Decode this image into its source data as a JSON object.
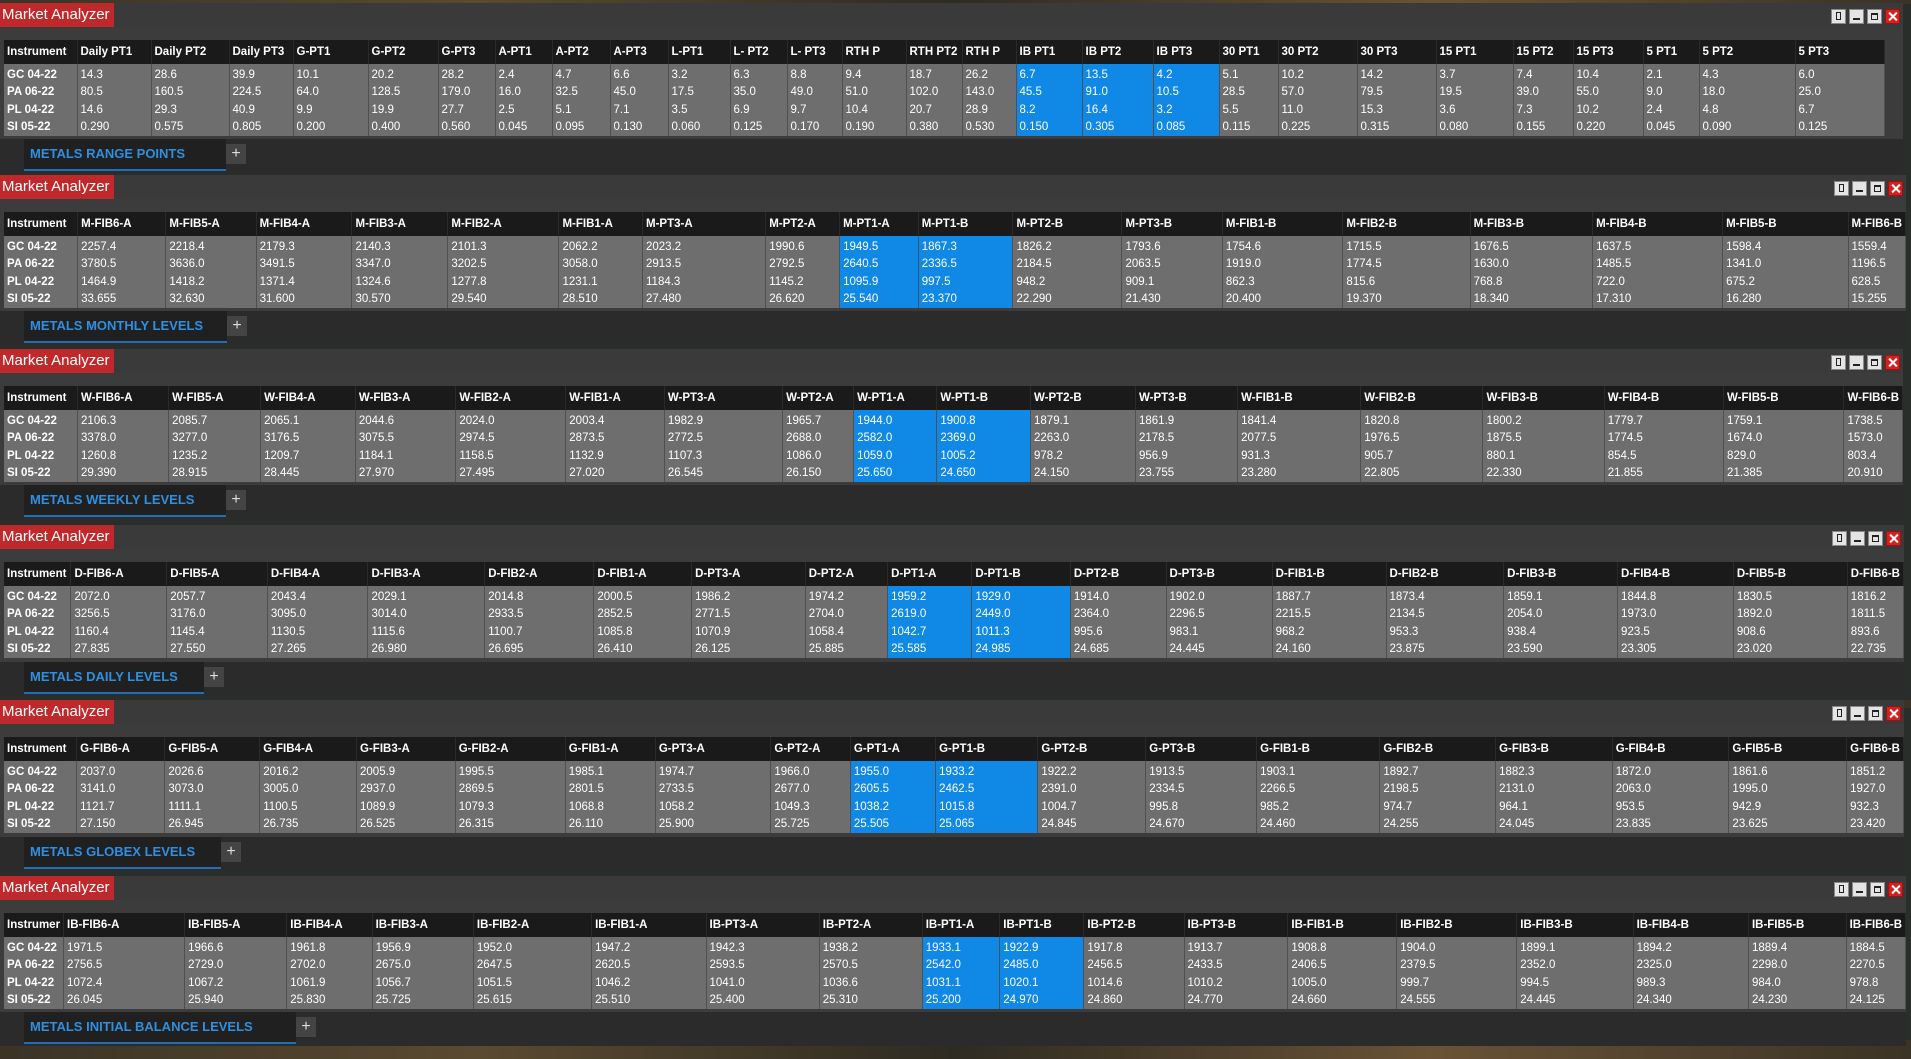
{
  "app_title": "Market Analyzer",
  "windows": [
    {
      "tab_label": "METALS RANGE POINTS",
      "headers": [
        "Instrument",
        "Daily PT1",
        "Daily PT2",
        "Daily PT3",
        "G-PT1",
        "G-PT2",
        "G-PT3",
        "A-PT1",
        "A-PT2",
        "A-PT3",
        "L-PT1",
        "L- PT2",
        "L- PT3",
        "RTH P",
        "RTH PT2",
        "RTH P",
        "IB PT1",
        "IB PT2",
        "IB PT3",
        "30 PT1",
        "30 PT2",
        "30 PT3",
        "15 PT1",
        "15 PT2",
        "15 PT3",
        "5 PT1",
        "5 PT2",
        "5 PT3"
      ],
      "rows": [
        [
          "GC 04-22",
          "14.3",
          "28.6",
          "39.9",
          "10.1",
          "20.2",
          "28.2",
          "2.4",
          "4.7",
          "6.6",
          "3.2",
          "6.3",
          "8.8",
          "9.4",
          "18.7",
          "26.2",
          "6.7",
          "13.5",
          "4.2",
          "5.1",
          "10.2",
          "14.2",
          "3.7",
          "7.4",
          "10.4",
          "2.1",
          "4.3",
          "6.0"
        ],
        [
          "PA 06-22",
          "80.5",
          "160.5",
          "224.5",
          "64.0",
          "128.5",
          "179.0",
          "16.0",
          "32.5",
          "45.0",
          "17.5",
          "35.0",
          "49.0",
          "51.0",
          "102.0",
          "143.0",
          "45.5",
          "91.0",
          "10.5",
          "28.5",
          "57.0",
          "79.5",
          "19.5",
          "39.0",
          "55.0",
          "9.0",
          "18.0",
          "25.0"
        ],
        [
          "PL 04-22",
          "14.6",
          "29.3",
          "40.9",
          "9.9",
          "19.9",
          "27.7",
          "2.5",
          "5.1",
          "7.1",
          "3.5",
          "6.9",
          "9.7",
          "10.4",
          "20.7",
          "28.9",
          "8.2",
          "16.4",
          "3.2",
          "5.5",
          "11.0",
          "15.3",
          "3.6",
          "7.3",
          "10.2",
          "2.4",
          "4.8",
          "6.7"
        ],
        [
          "SI 05-22",
          "0.290",
          "0.575",
          "0.805",
          "0.200",
          "0.400",
          "0.560",
          "0.045",
          "0.095",
          "0.130",
          "0.060",
          "0.125",
          "0.170",
          "0.190",
          "0.380",
          "0.530",
          "0.150",
          "0.305",
          "0.085",
          "0.115",
          "0.225",
          "0.315",
          "0.080",
          "0.155",
          "0.220",
          "0.045",
          "0.090",
          "0.125"
        ]
      ]
    },
    {
      "tab_label": "METALS MONTHLY LEVELS",
      "headers": [
        "Instrument",
        "M-FIB6-A",
        "M-FIB5-A",
        "M-FIB4-A",
        "M-FIB3-A",
        "M-FIB2-A",
        "M-FIB1-A",
        "M-PT3-A",
        "M-PT2-A",
        "M-PT1-A",
        "M-PT1-B",
        "M-PT2-B",
        "M-PT3-B",
        "M-FIB1-B",
        "M-FIB2-B",
        "M-FIB3-B",
        "M-FIB4-B",
        "M-FIB5-B",
        "M-FIB6-B"
      ],
      "rows": [
        [
          "GC 04-22",
          "2257.4",
          "2218.4",
          "2179.3",
          "2140.3",
          "2101.3",
          "2062.2",
          "2023.2",
          "1990.6",
          "1949.5",
          "1867.3",
          "1826.2",
          "1793.6",
          "1754.6",
          "1715.5",
          "1676.5",
          "1637.5",
          "1598.4",
          "1559.4"
        ],
        [
          "PA 06-22",
          "3780.5",
          "3636.0",
          "3491.5",
          "3347.0",
          "3202.5",
          "3058.0",
          "2913.5",
          "2792.5",
          "2640.5",
          "2336.5",
          "2184.5",
          "2063.5",
          "1919.0",
          "1774.5",
          "1630.0",
          "1485.5",
          "1341.0",
          "1196.5"
        ],
        [
          "PL 04-22",
          "1464.9",
          "1418.2",
          "1371.4",
          "1324.6",
          "1277.8",
          "1231.1",
          "1184.3",
          "1145.2",
          "1095.9",
          "997.5",
          "948.2",
          "909.1",
          "862.3",
          "815.6",
          "768.8",
          "722.0",
          "675.2",
          "628.5"
        ],
        [
          "SI 05-22",
          "33.655",
          "32.630",
          "31.600",
          "30.570",
          "29.540",
          "28.510",
          "27.480",
          "26.620",
          "25.540",
          "23.370",
          "22.290",
          "21.430",
          "20.400",
          "19.370",
          "18.340",
          "17.310",
          "16.280",
          "15.255"
        ]
      ]
    },
    {
      "tab_label": "METALS WEEKLY LEVELS",
      "headers": [
        "Instrument",
        "W-FIB6-A",
        "W-FIB5-A",
        "W-FIB4-A",
        "W-FIB3-A",
        "W-FIB2-A",
        "W-FIB1-A",
        "W-PT3-A",
        "W-PT2-A",
        "W-PT1-A",
        "W-PT1-B",
        "W-PT2-B",
        "W-PT3-B",
        "W-FIB1-B",
        "W-FIB2-B",
        "W-FIB3-B",
        "W-FIB4-B",
        "W-FIB5-B",
        "W-FIB6-B"
      ],
      "rows": [
        [
          "GC 04-22",
          "2106.3",
          "2085.7",
          "2065.1",
          "2044.6",
          "2024.0",
          "2003.4",
          "1982.9",
          "1965.7",
          "1944.0",
          "1900.8",
          "1879.1",
          "1861.9",
          "1841.4",
          "1820.8",
          "1800.2",
          "1779.7",
          "1759.1",
          "1738.5"
        ],
        [
          "PA 06-22",
          "3378.0",
          "3277.0",
          "3176.5",
          "3075.5",
          "2974.5",
          "2873.5",
          "2772.5",
          "2688.0",
          "2582.0",
          "2369.0",
          "2263.0",
          "2178.5",
          "2077.5",
          "1976.5",
          "1875.5",
          "1774.5",
          "1674.0",
          "1573.0"
        ],
        [
          "PL 04-22",
          "1260.8",
          "1235.2",
          "1209.7",
          "1184.1",
          "1158.5",
          "1132.9",
          "1107.3",
          "1086.0",
          "1059.0",
          "1005.2",
          "978.2",
          "956.9",
          "931.3",
          "905.7",
          "880.1",
          "854.5",
          "829.0",
          "803.4"
        ],
        [
          "SI 05-22",
          "29.390",
          "28.915",
          "28.445",
          "27.970",
          "27.495",
          "27.020",
          "26.545",
          "26.150",
          "25.650",
          "24.650",
          "24.150",
          "23.755",
          "23.280",
          "22.805",
          "22.330",
          "21.855",
          "21.385",
          "20.910"
        ]
      ]
    },
    {
      "tab_label": "METALS DAILY LEVELS",
      "headers": [
        "Instrument",
        "D-FIB6-A",
        "D-FIB5-A",
        "D-FIB4-A",
        "D-FIB3-A",
        "D-FIB2-A",
        "D-FIB1-A",
        "D-PT3-A",
        "D-PT2-A",
        "D-PT1-A",
        "D-PT1-B",
        "D-PT2-B",
        "D-PT3-B",
        "D-FIB1-B",
        "D-FIB2-B",
        "D-FIB3-B",
        "D-FIB4-B",
        "D-FIB5-B",
        "D-FIB6-B"
      ],
      "rows": [
        [
          "GC 04-22",
          "2072.0",
          "2057.7",
          "2043.4",
          "2029.1",
          "2014.8",
          "2000.5",
          "1986.2",
          "1974.2",
          "1959.2",
          "1929.0",
          "1914.0",
          "1902.0",
          "1887.7",
          "1873.4",
          "1859.1",
          "1844.8",
          "1830.5",
          "1816.2"
        ],
        [
          "PA 06-22",
          "3256.5",
          "3176.0",
          "3095.0",
          "3014.0",
          "2933.5",
          "2852.5",
          "2771.5",
          "2704.0",
          "2619.0",
          "2449.0",
          "2364.0",
          "2296.5",
          "2215.5",
          "2134.5",
          "2054.0",
          "1973.0",
          "1892.0",
          "1811.5"
        ],
        [
          "PL 04-22",
          "1160.4",
          "1145.4",
          "1130.5",
          "1115.6",
          "1100.7",
          "1085.8",
          "1070.9",
          "1058.4",
          "1042.7",
          "1011.3",
          "995.6",
          "983.1",
          "968.2",
          "953.3",
          "938.4",
          "923.5",
          "908.6",
          "893.6"
        ],
        [
          "SI 05-22",
          "27.835",
          "27.550",
          "27.265",
          "26.980",
          "26.695",
          "26.410",
          "26.125",
          "25.885",
          "25.585",
          "24.985",
          "24.685",
          "24.445",
          "24.160",
          "23.875",
          "23.590",
          "23.305",
          "23.020",
          "22.735"
        ]
      ]
    },
    {
      "tab_label": "METALS GLOBEX LEVELS",
      "headers": [
        "Instrument",
        "G-FIB6-A",
        "G-FIB5-A",
        "G-FIB4-A",
        "G-FIB3-A",
        "G-FIB2-A",
        "G-FIB1-A",
        "G-PT3-A",
        "G-PT2-A",
        "G-PT1-A",
        "G-PT1-B",
        "G-PT2-B",
        "G-PT3-B",
        "G-FIB1-B",
        "G-FIB2-B",
        "G-FIB3-B",
        "G-FIB4-B",
        "G-FIB5-B",
        "G-FIB6-B"
      ],
      "rows": [
        [
          "GC 04-22",
          "2037.0",
          "2026.6",
          "2016.2",
          "2005.9",
          "1995.5",
          "1985.1",
          "1974.7",
          "1966.0",
          "1955.0",
          "1933.2",
          "1922.2",
          "1913.5",
          "1903.1",
          "1892.7",
          "1882.3",
          "1872.0",
          "1861.6",
          "1851.2"
        ],
        [
          "PA 06-22",
          "3141.0",
          "3073.0",
          "3005.0",
          "2937.0",
          "2869.5",
          "2801.5",
          "2733.5",
          "2677.0",
          "2605.5",
          "2462.5",
          "2391.0",
          "2334.5",
          "2266.5",
          "2198.5",
          "2131.0",
          "2063.0",
          "1995.0",
          "1927.0"
        ],
        [
          "PL 04-22",
          "1121.7",
          "1111.1",
          "1100.5",
          "1089.9",
          "1079.3",
          "1068.8",
          "1058.2",
          "1049.3",
          "1038.2",
          "1015.8",
          "1004.7",
          "995.8",
          "985.2",
          "974.7",
          "964.1",
          "953.5",
          "942.9",
          "932.3"
        ],
        [
          "SI 05-22",
          "27.150",
          "26.945",
          "26.735",
          "26.525",
          "26.315",
          "26.110",
          "25.900",
          "25.725",
          "25.505",
          "25.065",
          "24.845",
          "24.670",
          "24.460",
          "24.255",
          "24.045",
          "23.835",
          "23.625",
          "23.420"
        ]
      ]
    },
    {
      "tab_label": "METALS  INITIAL BALANCE LEVELS",
      "headers": [
        "Instrumer",
        "IB-FIB6-A",
        "IB-FIB5-A",
        "IB-FIB4-A",
        "IB-FIB3-A",
        "IB-FIB2-A",
        "IB-FIB1-A",
        "IB-PT3-A",
        "IB-PT2-A",
        "IB-PT1-A",
        "IB-PT1-B",
        "IB-PT2-B",
        "IB-PT3-B",
        "IB-FIB1-B",
        "IB-FIB2-B",
        "IB-FIB3-B",
        "IB-FIB4-B",
        "IB-FIB5-B",
        "IB-FIB6-B"
      ],
      "rows": [
        [
          "GC 04-22",
          "1971.5",
          "1966.6",
          "1961.8",
          "1956.9",
          "1952.0",
          "1947.2",
          "1942.3",
          "1938.2",
          "1933.1",
          "1922.9",
          "1917.8",
          "1913.7",
          "1908.8",
          "1904.0",
          "1899.1",
          "1894.2",
          "1889.4",
          "1884.5"
        ],
        [
          "PA 06-22",
          "2756.5",
          "2729.0",
          "2702.0",
          "2675.0",
          "2647.5",
          "2620.5",
          "2593.5",
          "2570.5",
          "2542.0",
          "2485.0",
          "2456.5",
          "2433.5",
          "2406.5",
          "2379.5",
          "2352.0",
          "2325.0",
          "2298.0",
          "2270.5"
        ],
        [
          "PL 04-22",
          "1072.4",
          "1067.2",
          "1061.9",
          "1056.7",
          "1051.5",
          "1046.2",
          "1041.0",
          "1036.6",
          "1031.1",
          "1020.1",
          "1014.6",
          "1010.2",
          "1005.0",
          "999.7",
          "994.5",
          "989.3",
          "984.0",
          "978.8"
        ],
        [
          "SI 05-22",
          "26.045",
          "25.940",
          "25.830",
          "25.725",
          "25.615",
          "25.510",
          "25.400",
          "25.310",
          "25.200",
          "24.970",
          "24.860",
          "24.770",
          "24.660",
          "24.555",
          "24.445",
          "24.340",
          "24.230",
          "24.125"
        ]
      ]
    }
  ]
}
